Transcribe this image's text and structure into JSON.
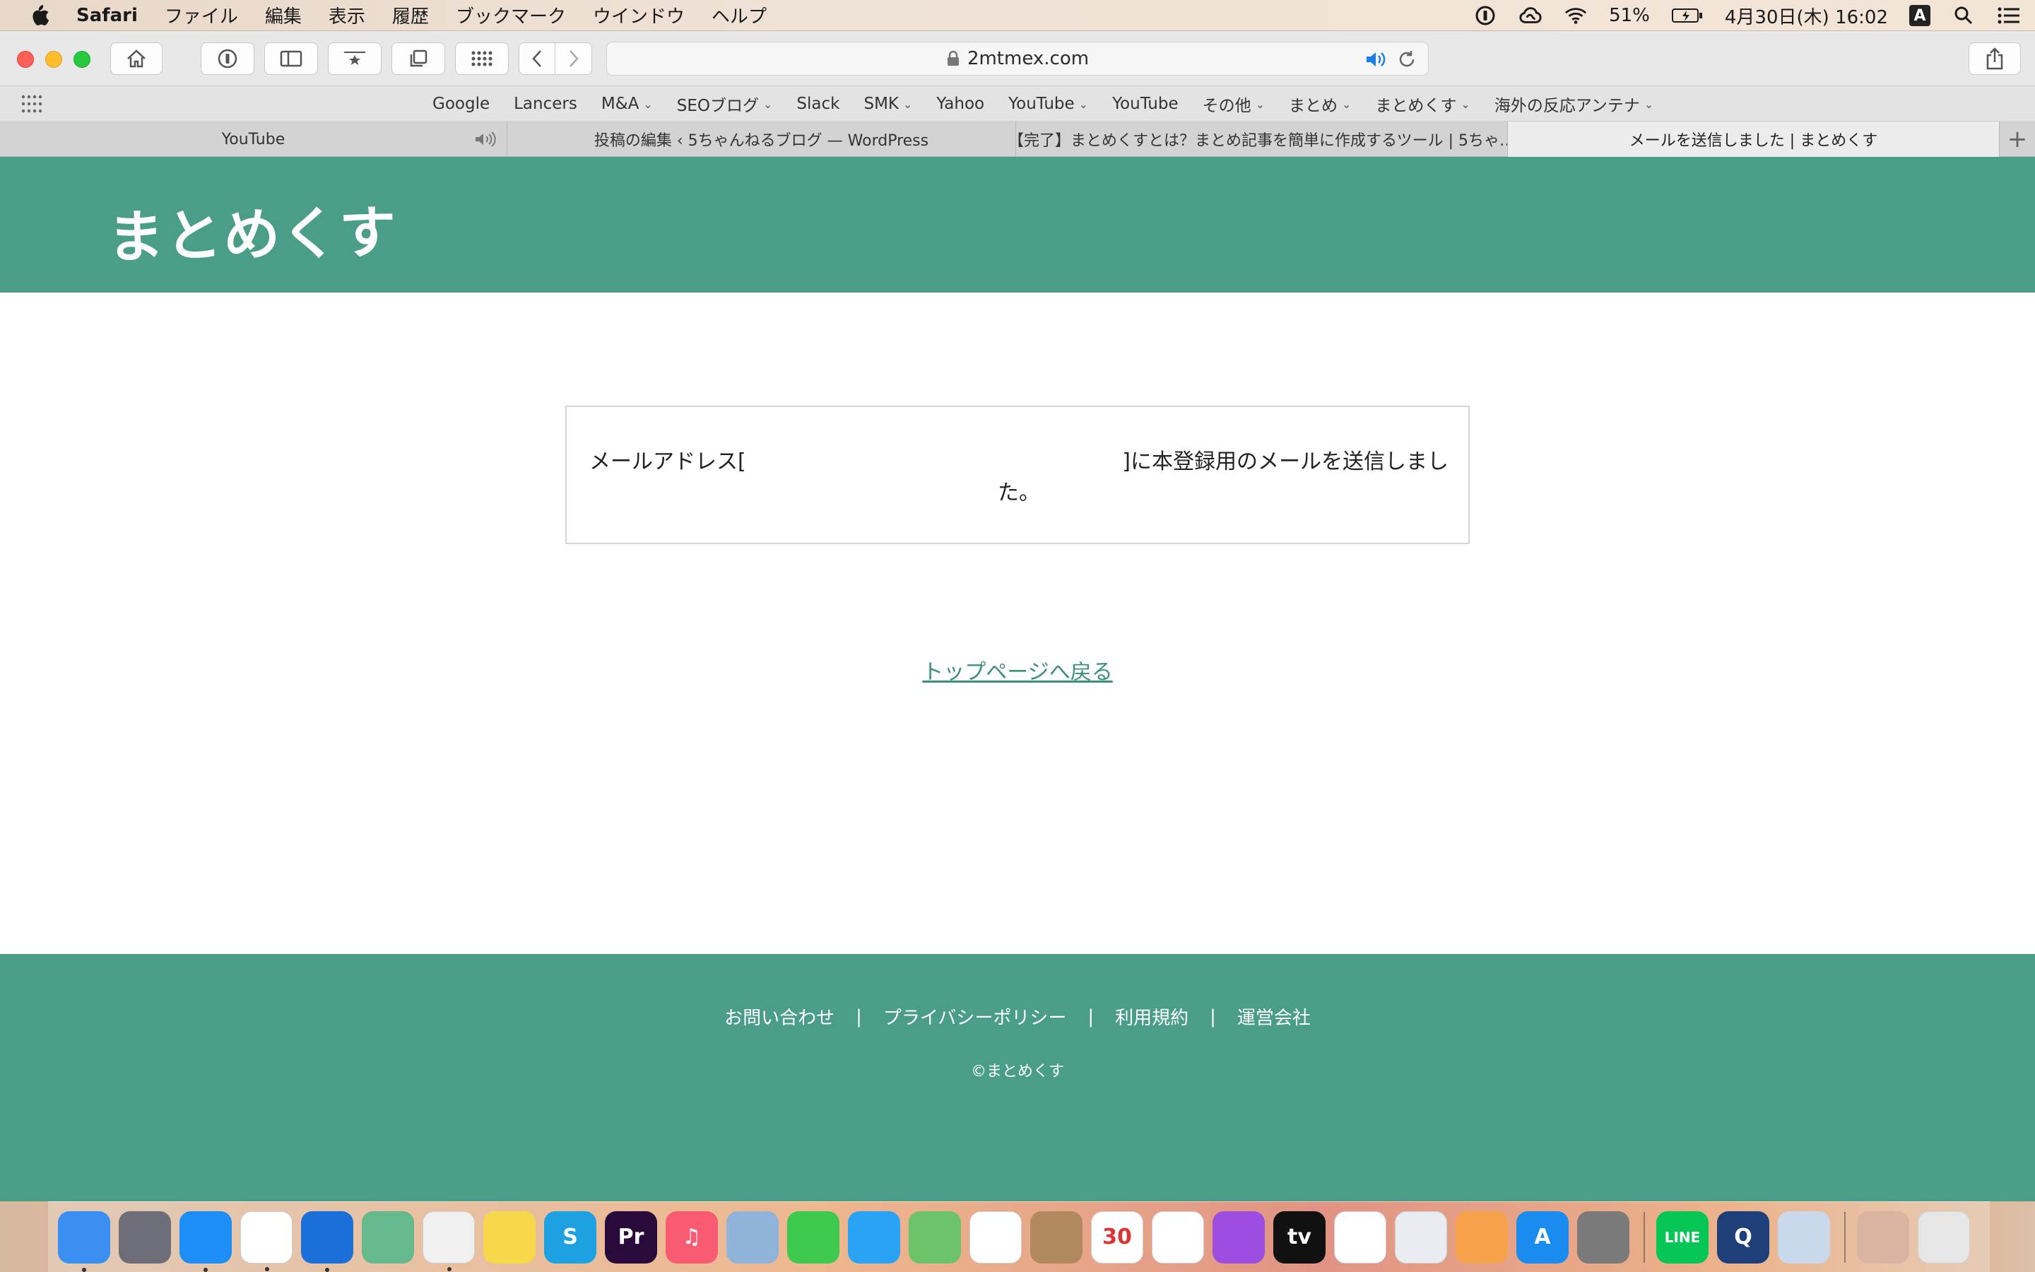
{
  "menubar": {
    "app_name": "Safari",
    "menus": [
      "ファイル",
      "編集",
      "表示",
      "履歴",
      "ブックマーク",
      "ウインドウ",
      "ヘルプ"
    ],
    "battery": "51%",
    "datetime": "4月30日(木)  16:02",
    "input_source": "A"
  },
  "browser": {
    "url": "2mtmex.com",
    "favorites": [
      {
        "label": "Google",
        "menu": false
      },
      {
        "label": "Lancers",
        "menu": false
      },
      {
        "label": "M&A",
        "menu": true
      },
      {
        "label": "SEOブログ",
        "menu": true
      },
      {
        "label": "Slack",
        "menu": false
      },
      {
        "label": "SMK",
        "menu": true
      },
      {
        "label": "Yahoo",
        "menu": false
      },
      {
        "label": "YouTube",
        "menu": true
      },
      {
        "label": "YouTube",
        "menu": false
      },
      {
        "label": "その他",
        "menu": true
      },
      {
        "label": "まとめ",
        "menu": true
      },
      {
        "label": "まとめくす",
        "menu": true
      },
      {
        "label": "海外の反応アンテナ",
        "menu": true
      }
    ],
    "tabs": [
      {
        "title": "YouTube",
        "active": false,
        "audio": true
      },
      {
        "title": "投稿の編集 ‹ 5ちゃんねるブログ — WordPress",
        "active": false,
        "audio": false
      },
      {
        "title": "【完了】まとめくすとは？まとめ記事を簡単に作成するツール | 5ちゃ…",
        "active": false,
        "audio": false
      },
      {
        "title": "メールを送信しました | まとめくす",
        "active": true,
        "audio": false
      }
    ],
    "new_tab": "+"
  },
  "page": {
    "site_logo": "まとめくす",
    "message_part1": "メールアドレス[",
    "message_part2": "]に本登録用のメールを送信しまし",
    "message_part3": "た。",
    "back_link": "トップページへ戻る",
    "footer_links": [
      "お問い合わせ",
      "プライバシーポリシー",
      "利用規約",
      "運営会社"
    ],
    "footer_separator": "|",
    "copyright": "©まとめくす"
  },
  "colors": {
    "brand_green": "#4a9d86",
    "link_green": "#3c8f78"
  },
  "dock": {
    "apps": [
      {
        "name": "finder-icon",
        "label": "",
        "color": "#3b8ff0",
        "running": true
      },
      {
        "name": "launchpad-icon",
        "label": "",
        "color": "#6e6e78",
        "running": false
      },
      {
        "name": "safari-icon",
        "label": "",
        "color": "#1d8ef5",
        "running": true
      },
      {
        "name": "slack-icon",
        "label": "",
        "color": "#ffffff",
        "running": true
      },
      {
        "name": "onepassword-icon",
        "label": "",
        "color": "#1a6fd8",
        "running": true
      },
      {
        "name": "atom-icon",
        "label": "",
        "color": "#66b98c",
        "running": false
      },
      {
        "name": "textedit-icon",
        "label": "",
        "color": "#f0f0f0",
        "running": true
      },
      {
        "name": "notes-icon",
        "label": "",
        "color": "#f7d84a",
        "running": false
      },
      {
        "name": "skype-icon",
        "label": "S",
        "color": "#1ea1e0",
        "running": false
      },
      {
        "name": "premiere-icon",
        "label": "Pr",
        "color": "#2a0a3a",
        "running": false
      },
      {
        "name": "music-icon",
        "label": "♫",
        "color": "#f85a72",
        "running": false
      },
      {
        "name": "preview-bird-icon",
        "label": "",
        "color": "#8fb3d9",
        "running": false
      },
      {
        "name": "facetime-icon",
        "label": "",
        "color": "#3ec94f",
        "running": false
      },
      {
        "name": "messages-icon",
        "label": "",
        "color": "#2aa3f5",
        "running": false
      },
      {
        "name": "maps-icon",
        "label": "",
        "color": "#6cc36a",
        "running": false
      },
      {
        "name": "photos-icon",
        "label": "",
        "color": "#ffffff",
        "running": false
      },
      {
        "name": "contacts-icon",
        "label": "",
        "color": "#b08a5e",
        "running": false
      },
      {
        "name": "calendar-icon",
        "label": "30",
        "color": "#ffffff",
        "running": false
      },
      {
        "name": "reminders-icon",
        "label": "",
        "color": "#ffffff",
        "running": false
      },
      {
        "name": "podcasts-icon",
        "label": "",
        "color": "#9b4ee0",
        "running": false
      },
      {
        "name": "apple-tv-icon",
        "label": "tv",
        "color": "#111111",
        "running": false
      },
      {
        "name": "numbers-icon",
        "label": "",
        "color": "#ffffff",
        "running": false
      },
      {
        "name": "keynote-icon",
        "label": "",
        "color": "#e9edf2",
        "running": false
      },
      {
        "name": "pages-icon",
        "label": "",
        "color": "#f5a24a",
        "running": false
      },
      {
        "name": "app-store-icon",
        "label": "A",
        "color": "#1a8cf0",
        "running": false
      },
      {
        "name": "system-preferences-icon",
        "label": "",
        "color": "#7a7a7a",
        "running": false
      }
    ],
    "apps_right": [
      {
        "name": "line-icon",
        "label": "LINE",
        "color": "#06c755",
        "running": false
      },
      {
        "name": "quicktime-icon",
        "label": "Q",
        "color": "#1e3f7a",
        "running": false
      },
      {
        "name": "preview-icon",
        "label": "",
        "color": "#c9d8ea",
        "running": false
      }
    ],
    "apps_far_right": [
      {
        "name": "photo-stack-icon",
        "label": "",
        "color": "#d9b4a0",
        "running": false
      },
      {
        "name": "trash-icon",
        "label": "",
        "color": "#e6e6e6",
        "running": false
      }
    ]
  }
}
